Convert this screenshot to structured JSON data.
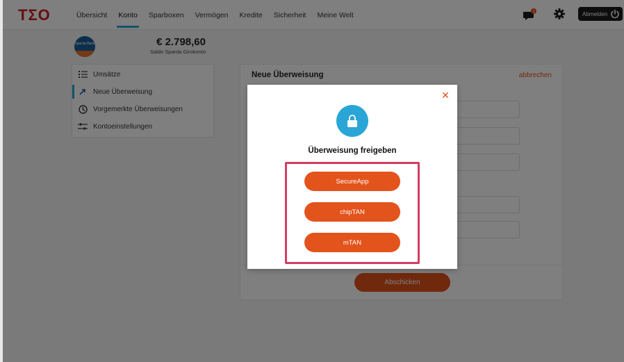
{
  "app": {
    "logo": "TΣO"
  },
  "nav": {
    "items": [
      {
        "label": "Übersicht"
      },
      {
        "label": "Konto",
        "active": true
      },
      {
        "label": "Sparboxen"
      },
      {
        "label": "Vermögen"
      },
      {
        "label": "Kredite"
      },
      {
        "label": "Sicherheit"
      },
      {
        "label": "Meine Welt"
      }
    ],
    "notification_count": "1",
    "logout_label": "Abmelden"
  },
  "account": {
    "bank_logo_text": "Sparda-Bank",
    "balance": "€ 2.798,60",
    "balance_label": "Saldo Sparda Girokonto"
  },
  "sidebar": {
    "items": [
      {
        "label": "Umsätze",
        "icon": "list-icon"
      },
      {
        "label": "Neue Überweisung",
        "icon": "arrow-icon",
        "active": true
      },
      {
        "label": "Vorgemerkte Überweisungen",
        "icon": "clock-icon"
      },
      {
        "label": "Kontoeinstellungen",
        "icon": "sliders-icon"
      }
    ]
  },
  "panel": {
    "title": "Neue Überweisung",
    "cancel_label": "abbrechen",
    "submit_label": "Abschicken"
  },
  "modal": {
    "title": "Überweisung freigeben",
    "buttons": [
      {
        "label": "SecureApp"
      },
      {
        "label": "chipTAN"
      },
      {
        "label": "mTAN"
      }
    ],
    "close_symbol": "✕"
  },
  "colors": {
    "accent_orange": "#e3531c",
    "accent_blue": "#2aa6d6",
    "highlight": "#d43d61",
    "logo_red": "#cc1d22"
  }
}
